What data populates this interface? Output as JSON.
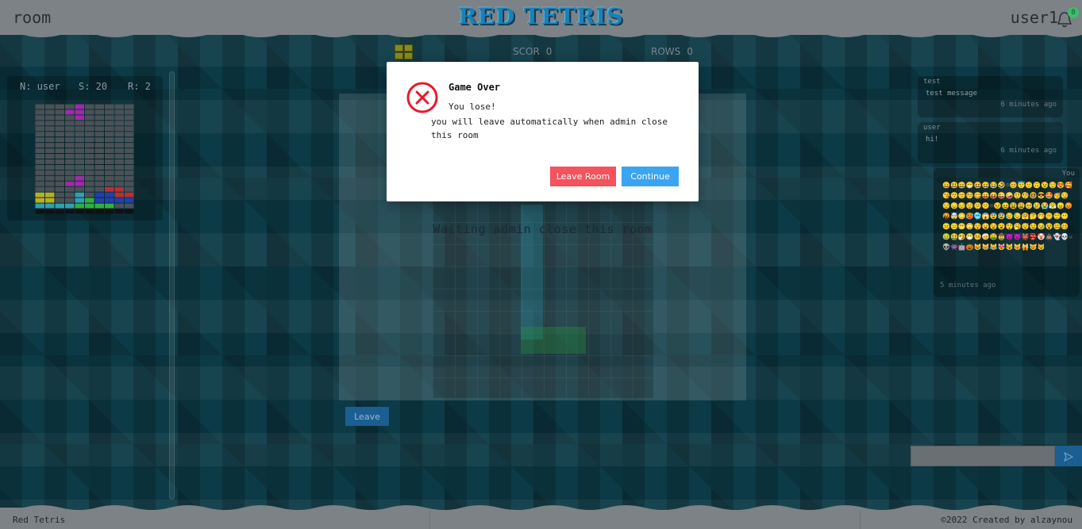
{
  "header": {
    "room_name": "room",
    "logo_text": "RED TETRIS",
    "username": "user1",
    "notification_count": "0"
  },
  "status": {
    "score_label": "SCOR",
    "score_value": "0",
    "rows_label": "ROWS",
    "rows_value": "0"
  },
  "opponent": {
    "name": "N: user",
    "score": "S: 20",
    "rows": "R: 2"
  },
  "board": {
    "waiting_text": "Waiting admin close this room",
    "leave_label": "Leave"
  },
  "chat": {
    "messages": [
      {
        "author": "test",
        "text": "test message",
        "time": "6 minutes ago"
      },
      {
        "author": "user",
        "text": "hi!",
        "time": "6 minutes ago"
      }
    ],
    "emoji_message": {
      "author": "You",
      "emojis": "😀😃😄😁😆😅😂🤣☺😊😇🙂🙃😉😌😍🥰😘😗😙😚😋😛😝😜🤪🤨🧐🤓😎🤩🥳😏😒😞😔😟😕🙁☹😣😖😫😩🥺😢😭😤😠😡🤬🤯😳🥵🥶😱😨😰😥😓🤗🤔🤭🤫🤥😶😐😑😬🙄😯😦😧😮😲🥱😴🤤😪😵🤐🥴🤢🤮🤧😷🤒🤕🤑🤠😈👿👹👺🤡💩👻💀☠👽👾🤖🎃😺😸😹😻😼😽🙀😿😾",
      "time": "5 minutes ago"
    },
    "input_placeholder": ""
  },
  "footer": {
    "left_text": "Red Tetris",
    "right_text": "©2022 Created by alzaynou"
  },
  "modal": {
    "title": "Game Over",
    "line1": "You lose!",
    "line2": "you will leave automatically when admin close this room",
    "leave_room_label": "Leave Room",
    "continue_label": "Continue"
  },
  "colors": {
    "header_bg": "#7c8286",
    "logo": "#1e7fb2",
    "leave_room_button": "#f4525d",
    "continue_button": "#3aa4f0",
    "error_icon": "#e8192c"
  }
}
